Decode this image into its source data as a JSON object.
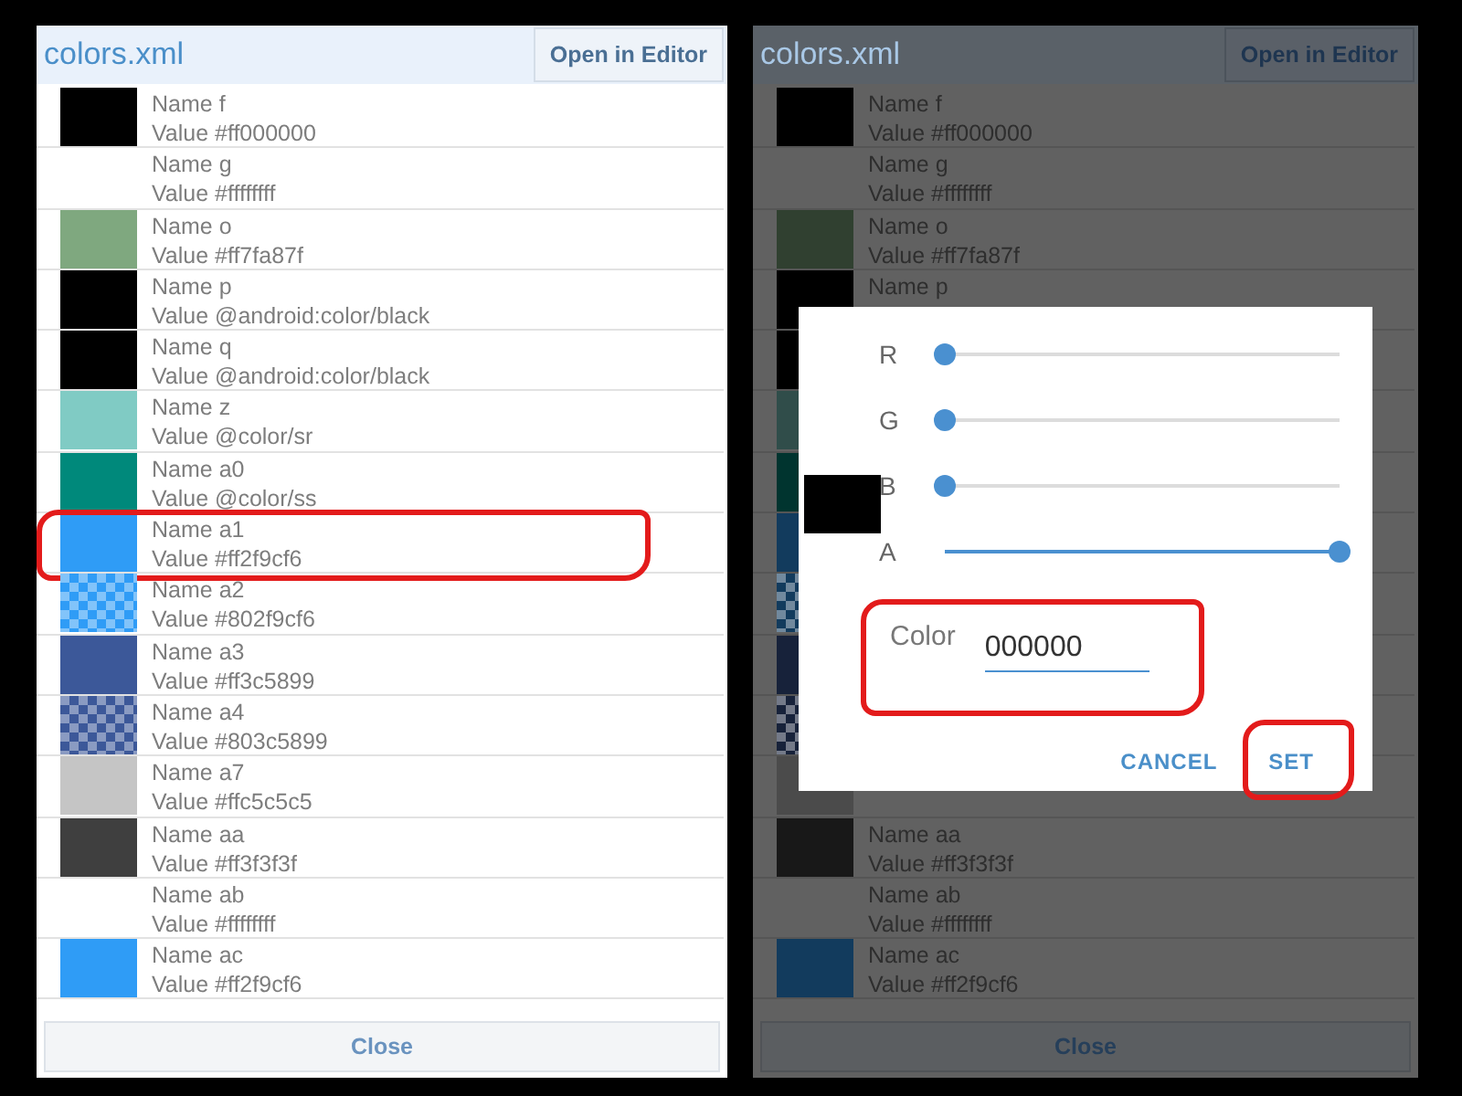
{
  "left_panel": {
    "title": "colors.xml",
    "open_button": "Open in Editor",
    "rows": [
      {
        "name": "Name f",
        "value": "Value  #ff000000",
        "kind": "solid",
        "color": "#000000",
        "circled": false
      },
      {
        "name": "Name g",
        "value": "Value  #ffffffff",
        "kind": "none",
        "circled": false
      },
      {
        "name": "Name o",
        "value": "Value  #ff7fa87f",
        "kind": "solid",
        "color": "#7fa87f",
        "circled": false
      },
      {
        "name": "Name p",
        "value": "Value  @android:color/black",
        "kind": "solid",
        "color": "#000000",
        "circled": false
      },
      {
        "name": "Name q",
        "value": "Value  @android:color/black",
        "kind": "solid",
        "color": "#000000",
        "circled": false
      },
      {
        "name": "Name z",
        "value": "Value  @color/sr",
        "kind": "solid",
        "color": "#80cbc4",
        "circled": false
      },
      {
        "name": "Name a0",
        "value": "Value  @color/ss",
        "kind": "solid",
        "color": "#00897b",
        "circled": false
      },
      {
        "name": "Name a1",
        "value": "Value  #ff2f9cf6",
        "kind": "solid",
        "color": "#2f9cf6",
        "circled": true
      },
      {
        "name": "Name a2",
        "value": "Value  #802f9cf6",
        "kind": "checkered",
        "color": "#2f9cf6",
        "circled": false
      },
      {
        "name": "Name a3",
        "value": "Value  #ff3c5899",
        "kind": "solid",
        "color": "#3c5899",
        "circled": false
      },
      {
        "name": "Name a4",
        "value": "Value  #803c5899",
        "kind": "checkered",
        "color": "#3c5899",
        "circled": false
      },
      {
        "name": "Name a7",
        "value": "Value  #ffc5c5c5",
        "kind": "solid",
        "color": "#c5c5c5",
        "circled": false
      },
      {
        "name": "Name aa",
        "value": "Value  #ff3f3f3f",
        "kind": "solid",
        "color": "#3f3f3f",
        "circled": false
      },
      {
        "name": "Name ab",
        "value": "Value  #ffffffff",
        "kind": "none",
        "circled": false
      },
      {
        "name": "Name ac",
        "value": "Value  #ff2f9cf6",
        "kind": "solid",
        "color": "#2f9cf6",
        "circled": false
      }
    ],
    "close_button": "Close"
  },
  "right_panel": {
    "title": "colors.xml",
    "open_button": "Open in Editor",
    "dimmed": true,
    "rows": [
      {
        "name": "Name f",
        "value": "Value  #ff000000",
        "kind": "solid",
        "color": "#000000",
        "circled": false
      },
      {
        "name": "Name g",
        "value": "Value  #ffffffff",
        "kind": "none",
        "circled": false
      },
      {
        "name": "Name o",
        "value": "Value  #ff7fa87f",
        "kind": "solid",
        "color": "#304030",
        "circled": false
      },
      {
        "name": "Name p",
        "kind": "solid",
        "color": "#000000",
        "circled": false
      },
      {
        "kind": "solid",
        "color": "#000000",
        "circled": false
      },
      {
        "kind": "solid",
        "color": "#304d4a",
        "circled": false
      },
      {
        "kind": "solid",
        "color": "#00342f",
        "circled": false
      },
      {
        "kind": "solid",
        "color": "#123b5d",
        "circled": false
      },
      {
        "kind": "checkered",
        "color": "#123b5d",
        "circled": false
      },
      {
        "kind": "solid",
        "color": "#17223a",
        "circled": false
      },
      {
        "kind": "checkered",
        "color": "#17223a",
        "circled": false
      },
      {
        "kind": "solid",
        "color": "#4b4b4b",
        "circled": false
      },
      {
        "name": "Name aa",
        "value": "Value  #ff3f3f3f",
        "kind": "solid",
        "color": "#181818",
        "circled": false
      },
      {
        "name": "Name ab",
        "value": "Value  #ffffffff",
        "kind": "none",
        "circled": false
      },
      {
        "name": "Name ac",
        "value": "Value  #ff2f9cf6",
        "kind": "solid",
        "color": "#123b5d",
        "circled": false
      }
    ],
    "close_button": "Close",
    "dialog": {
      "preview": {
        "color": "#000000"
      },
      "sliders": [
        {
          "label": "R",
          "level": 0
        },
        {
          "label": "G",
          "level": 0
        },
        {
          "label": "B",
          "level": 0
        },
        {
          "label": "A",
          "level": 1
        }
      ],
      "color_label": "Color",
      "color_value": "000000",
      "color_circled": true,
      "buttons": [
        {
          "label": "CANCEL",
          "circled": false
        },
        {
          "label": "SET",
          "circled": true
        }
      ]
    }
  }
}
